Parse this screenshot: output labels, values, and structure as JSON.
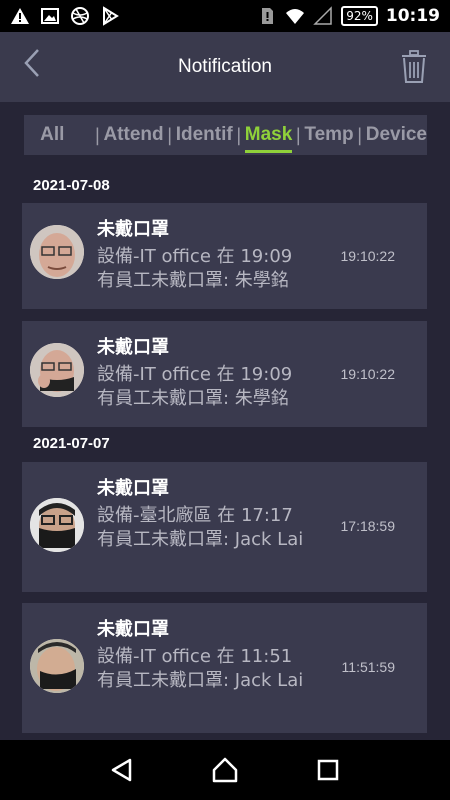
{
  "status_bar": {
    "battery": "92%",
    "time": "10:19"
  },
  "header": {
    "title": "Notification"
  },
  "tabs": [
    {
      "label": "All",
      "active": false
    },
    {
      "label": "Attend",
      "active": false
    },
    {
      "label": "Identif",
      "active": false
    },
    {
      "label": "Mask",
      "active": true
    },
    {
      "label": "Temp",
      "active": false
    },
    {
      "label": "Device",
      "active": false
    }
  ],
  "groups": [
    {
      "date": "2021-07-08",
      "items": [
        {
          "title": "未戴口罩",
          "line1": "設備-IT office 在 19:09",
          "line2": "有員工未戴口罩: 朱學銘",
          "time": "19:10:22"
        },
        {
          "title": "未戴口罩",
          "line1": "設備-IT office 在 19:09",
          "line2": "有員工未戴口罩: 朱學銘",
          "time": "19:10:22"
        }
      ]
    },
    {
      "date": "2021-07-07",
      "items": [
        {
          "title": "未戴口罩",
          "line1": "設備-臺北廠區 在 17:17",
          "line2": "有員工未戴口罩: Jack Lai",
          "time": "17:18:59"
        },
        {
          "title": "未戴口罩",
          "line1": "設備-IT office 在 11:51",
          "line2": "有員工未戴口罩: Jack Lai",
          "time": "11:51:59"
        }
      ]
    }
  ],
  "colors": {
    "background": "#262536",
    "card": "#3a3a4e",
    "accent": "#8fd13a"
  }
}
